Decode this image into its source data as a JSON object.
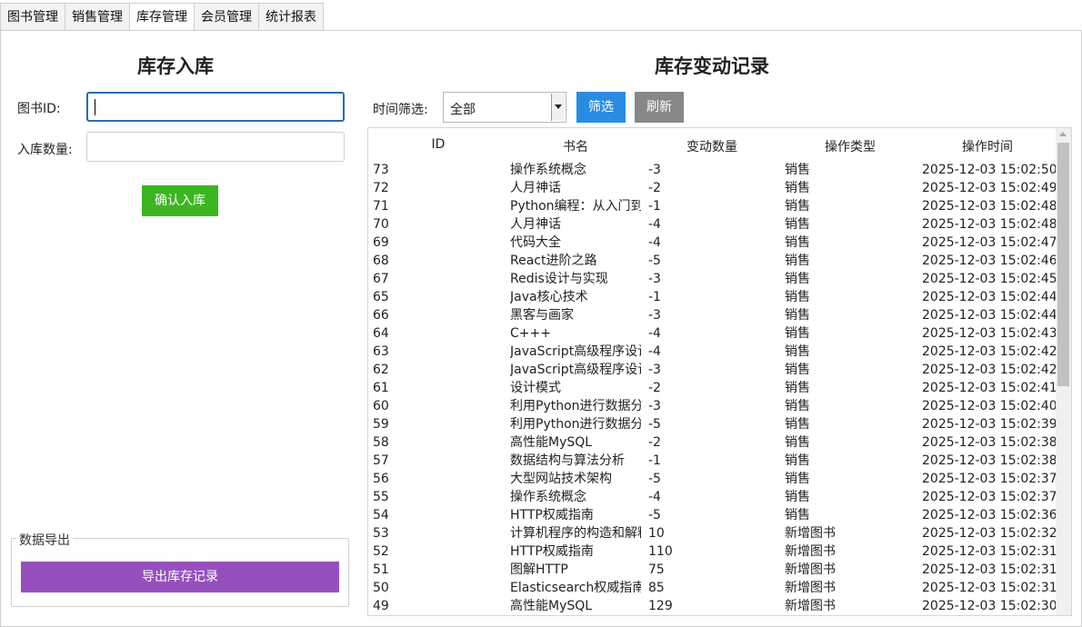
{
  "tabs": [
    {
      "label": "图书管理"
    },
    {
      "label": "销售管理"
    },
    {
      "label": "库存管理"
    },
    {
      "label": "会员管理"
    },
    {
      "label": "统计报表"
    }
  ],
  "active_tab": "库存管理",
  "stock_in": {
    "title": "库存入库",
    "book_id_label": "图书ID:",
    "book_id_value": "",
    "quantity_label": "入库数量:",
    "quantity_value": "",
    "confirm_button": "确认入库"
  },
  "export": {
    "legend": "数据导出",
    "button": "导出库存记录"
  },
  "records": {
    "title": "库存变动记录",
    "filter_label": "时间筛选:",
    "filter_value": "全部",
    "filter_button": "筛选",
    "refresh_button": "刷新",
    "columns": [
      "ID",
      "书名",
      "变动数量",
      "操作类型",
      "操作时间"
    ],
    "rows": [
      {
        "id": "73",
        "name": "操作系统概念",
        "change": "-3",
        "type": "销售",
        "time": "2025-12-03 15:02:50"
      },
      {
        "id": "72",
        "name": "人月神话",
        "change": "-2",
        "type": "销售",
        "time": "2025-12-03 15:02:49"
      },
      {
        "id": "71",
        "name": "Python编程：从入门到实践",
        "change": "-1",
        "type": "销售",
        "time": "2025-12-03 15:02:48"
      },
      {
        "id": "70",
        "name": "人月神话",
        "change": "-4",
        "type": "销售",
        "time": "2025-12-03 15:02:48"
      },
      {
        "id": "69",
        "name": "代码大全",
        "change": "-4",
        "type": "销售",
        "time": "2025-12-03 15:02:47"
      },
      {
        "id": "68",
        "name": "React进阶之路",
        "change": "-5",
        "type": "销售",
        "time": "2025-12-03 15:02:46"
      },
      {
        "id": "67",
        "name": "Redis设计与实现",
        "change": "-3",
        "type": "销售",
        "time": "2025-12-03 15:02:45"
      },
      {
        "id": "65",
        "name": "Java核心技术",
        "change": "-1",
        "type": "销售",
        "time": "2025-12-03 15:02:44"
      },
      {
        "id": "66",
        "name": "黑客与画家",
        "change": "-3",
        "type": "销售",
        "time": "2025-12-03 15:02:44"
      },
      {
        "id": "64",
        "name": "C+++",
        "change": "-4",
        "type": "销售",
        "time": "2025-12-03 15:02:43"
      },
      {
        "id": "63",
        "name": "JavaScript高级程序设计",
        "change": "-4",
        "type": "销售",
        "time": "2025-12-03 15:02:42"
      },
      {
        "id": "62",
        "name": "JavaScript高级程序设计",
        "change": "-3",
        "type": "销售",
        "time": "2025-12-03 15:02:42"
      },
      {
        "id": "61",
        "name": "设计模式",
        "change": "-2",
        "type": "销售",
        "time": "2025-12-03 15:02:41"
      },
      {
        "id": "60",
        "name": "利用Python进行数据分析",
        "change": "-3",
        "type": "销售",
        "time": "2025-12-03 15:02:40"
      },
      {
        "id": "59",
        "name": "利用Python进行数据分析",
        "change": "-5",
        "type": "销售",
        "time": "2025-12-03 15:02:39"
      },
      {
        "id": "58",
        "name": "高性能MySQL",
        "change": "-2",
        "type": "销售",
        "time": "2025-12-03 15:02:38"
      },
      {
        "id": "57",
        "name": "数据结构与算法分析",
        "change": "-1",
        "type": "销售",
        "time": "2025-12-03 15:02:38"
      },
      {
        "id": "56",
        "name": "大型网站技术架构",
        "change": "-5",
        "type": "销售",
        "time": "2025-12-03 15:02:37"
      },
      {
        "id": "55",
        "name": "操作系统概念",
        "change": "-4",
        "type": "销售",
        "time": "2025-12-03 15:02:37"
      },
      {
        "id": "54",
        "name": "HTTP权威指南",
        "change": "-5",
        "type": "销售",
        "time": "2025-12-03 15:02:36"
      },
      {
        "id": "53",
        "name": "计算机程序的构造和解释",
        "change": "10",
        "type": "新增图书",
        "time": "2025-12-03 15:02:32"
      },
      {
        "id": "52",
        "name": "HTTP权威指南",
        "change": "110",
        "type": "新增图书",
        "time": "2025-12-03 15:02:31"
      },
      {
        "id": "51",
        "name": "图解HTTP",
        "change": "75",
        "type": "新增图书",
        "time": "2025-12-03 15:02:31"
      },
      {
        "id": "50",
        "name": "Elasticsearch权威指南",
        "change": "85",
        "type": "新增图书",
        "time": "2025-12-03 15:02:31"
      },
      {
        "id": "49",
        "name": "高性能MySQL",
        "change": "129",
        "type": "新增图书",
        "time": "2025-12-03 15:02:30"
      }
    ]
  },
  "colors": {
    "confirm_button": "#3cb521",
    "filter_button": "#2a8ce0",
    "refresh_button": "#888888",
    "export_button": "#9650bd",
    "focus_border": "#2b6cb0"
  }
}
